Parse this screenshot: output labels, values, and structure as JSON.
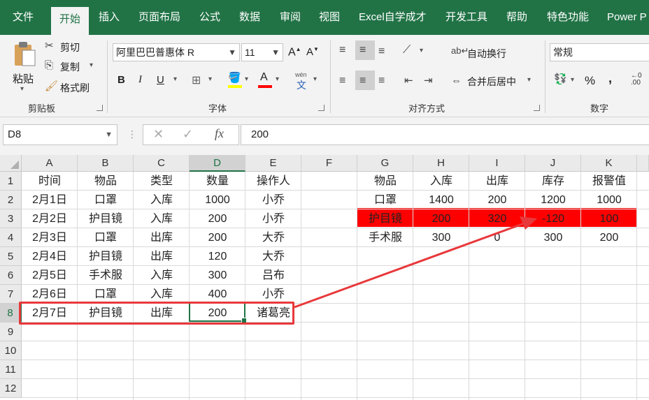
{
  "menu_tabs": [
    "文件",
    "开始",
    "插入",
    "页面布局",
    "公式",
    "数据",
    "审阅",
    "视图",
    "Excel自学成才",
    "开发工具",
    "帮助",
    "特色功能",
    "Power P"
  ],
  "ribbon": {
    "clipboard": {
      "paste": "粘贴",
      "cut": "剪切",
      "copy": "复制",
      "format_painter": "格式刷",
      "group_label": "剪贴板"
    },
    "font": {
      "font_name": "阿里巴巴普惠体 R",
      "font_size": "11",
      "bold": "B",
      "italic": "I",
      "underline": "U",
      "phonetic": "wén",
      "group_label": "字体",
      "fill_color": "#ffff00",
      "font_color": "#ff0000"
    },
    "alignment": {
      "wrap_text": "自动换行",
      "merge_center": "合并后居中",
      "group_label": "对齐方式"
    },
    "number": {
      "format": "常规",
      "percent": "%",
      "comma": ",",
      "group_label": "数字"
    }
  },
  "formula_bar": {
    "name_box": "D8",
    "fx": "fx",
    "value": "200"
  },
  "columns": [
    "A",
    "B",
    "C",
    "D",
    "E",
    "F",
    "G",
    "H",
    "I",
    "J",
    "K"
  ],
  "rows": [
    "1",
    "2",
    "3",
    "4",
    "5",
    "6",
    "7",
    "8",
    "9",
    "10",
    "11",
    "12"
  ],
  "left_table": [
    [
      "时间",
      "物品",
      "类型",
      "数量",
      "操作人"
    ],
    [
      "2月1日",
      "口罩",
      "入库",
      "1000",
      "小乔"
    ],
    [
      "2月2日",
      "护目镜",
      "入库",
      "200",
      "小乔"
    ],
    [
      "2月3日",
      "口罩",
      "出库",
      "200",
      "大乔"
    ],
    [
      "2月4日",
      "护目镜",
      "出库",
      "120",
      "大乔"
    ],
    [
      "2月5日",
      "手术服",
      "入库",
      "300",
      "吕布"
    ],
    [
      "2月6日",
      "口罩",
      "入库",
      "400",
      "小乔"
    ],
    [
      "2月7日",
      "护目镜",
      "出库",
      "200",
      "诸葛亮"
    ]
  ],
  "right_table": [
    [
      "物品",
      "入库",
      "出库",
      "库存",
      "报警值"
    ],
    [
      "口罩",
      "1400",
      "200",
      "1200",
      "1000"
    ],
    [
      "护目镜",
      "200",
      "320",
      "-120",
      "100"
    ],
    [
      "手术服",
      "300",
      "0",
      "300",
      "200"
    ]
  ],
  "colors": {
    "excel_green": "#217346",
    "alert_red": "#ff0000",
    "annotation_red": "#e8383b"
  }
}
